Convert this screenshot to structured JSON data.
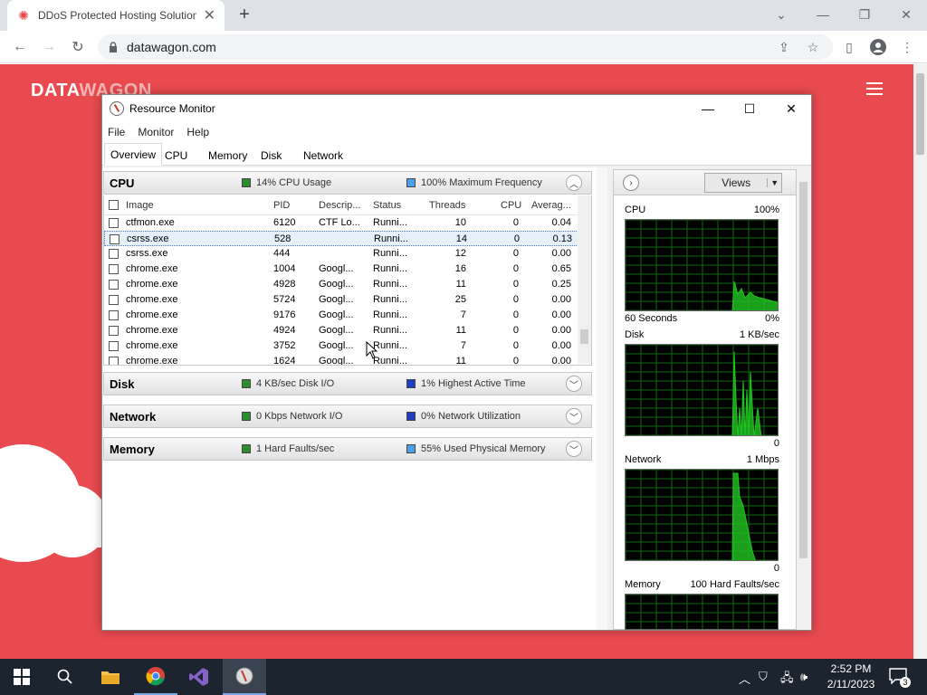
{
  "browser": {
    "tab_title": "DDoS Protected Hosting Solution",
    "url": "datawagon.com"
  },
  "site": {
    "logo_a": "DATA",
    "logo_b": "WAGON"
  },
  "rm": {
    "title": "Resource Monitor",
    "menu": [
      "File",
      "Monitor",
      "Help"
    ],
    "tabs": [
      "Overview",
      "CPU",
      "Memory",
      "Disk",
      "Network"
    ],
    "sections": {
      "cpu": {
        "name": "CPU",
        "stat1": "14% CPU Usage",
        "stat2": "100% Maximum Frequency"
      },
      "disk": {
        "name": "Disk",
        "stat1": "4 KB/sec Disk I/O",
        "stat2": "1% Highest Active Time"
      },
      "network": {
        "name": "Network",
        "stat1": "0 Kbps Network I/O",
        "stat2": "0% Network Utilization"
      },
      "memory": {
        "name": "Memory",
        "stat1": "1 Hard Faults/sec",
        "stat2": "55% Used Physical Memory"
      }
    },
    "columns": [
      "Image",
      "PID",
      "Descrip...",
      "Status",
      "Threads",
      "CPU",
      "Averag..."
    ],
    "rows": [
      {
        "image": "ctfmon.exe",
        "pid": "6120",
        "desc": "CTF Lo...",
        "status": "Runni...",
        "threads": "10",
        "cpu": "0",
        "avg": "0.04"
      },
      {
        "image": "csrss.exe",
        "pid": "528",
        "desc": "",
        "status": "Runni...",
        "threads": "14",
        "cpu": "0",
        "avg": "0.13"
      },
      {
        "image": "csrss.exe",
        "pid": "444",
        "desc": "",
        "status": "Runni...",
        "threads": "12",
        "cpu": "0",
        "avg": "0.00"
      },
      {
        "image": "chrome.exe",
        "pid": "1004",
        "desc": "Googl...",
        "status": "Runni...",
        "threads": "16",
        "cpu": "0",
        "avg": "0.65"
      },
      {
        "image": "chrome.exe",
        "pid": "4928",
        "desc": "Googl...",
        "status": "Runni...",
        "threads": "11",
        "cpu": "0",
        "avg": "0.25"
      },
      {
        "image": "chrome.exe",
        "pid": "5724",
        "desc": "Googl...",
        "status": "Runni...",
        "threads": "25",
        "cpu": "0",
        "avg": "0.00"
      },
      {
        "image": "chrome.exe",
        "pid": "9176",
        "desc": "Googl...",
        "status": "Runni...",
        "threads": "7",
        "cpu": "0",
        "avg": "0.00"
      },
      {
        "image": "chrome.exe",
        "pid": "4924",
        "desc": "Googl...",
        "status": "Runni...",
        "threads": "11",
        "cpu": "0",
        "avg": "0.00"
      },
      {
        "image": "chrome.exe",
        "pid": "3752",
        "desc": "Googl...",
        "status": "Runni...",
        "threads": "7",
        "cpu": "0",
        "avg": "0.00"
      },
      {
        "image": "chrome.exe",
        "pid": "1624",
        "desc": "Googl...",
        "status": "Runni...",
        "threads": "11",
        "cpu": "0",
        "avg": "0.00"
      }
    ],
    "views_label": "Views",
    "graphs": {
      "cpu": {
        "name": "CPU",
        "max": "100%",
        "time": "60 Seconds",
        "min": "0%"
      },
      "disk": {
        "name": "Disk",
        "max": "1 KB/sec",
        "min": "0"
      },
      "network": {
        "name": "Network",
        "max": "1 Mbps",
        "min": "0"
      },
      "memory": {
        "name": "Memory",
        "max": "100 Hard Faults/sec"
      }
    }
  },
  "taskbar": {
    "time": "2:52 PM",
    "date": "2/11/2023",
    "notifications": "3"
  },
  "colors": {
    "site_red": "#e84a4f",
    "graph_green": "#22c522"
  }
}
